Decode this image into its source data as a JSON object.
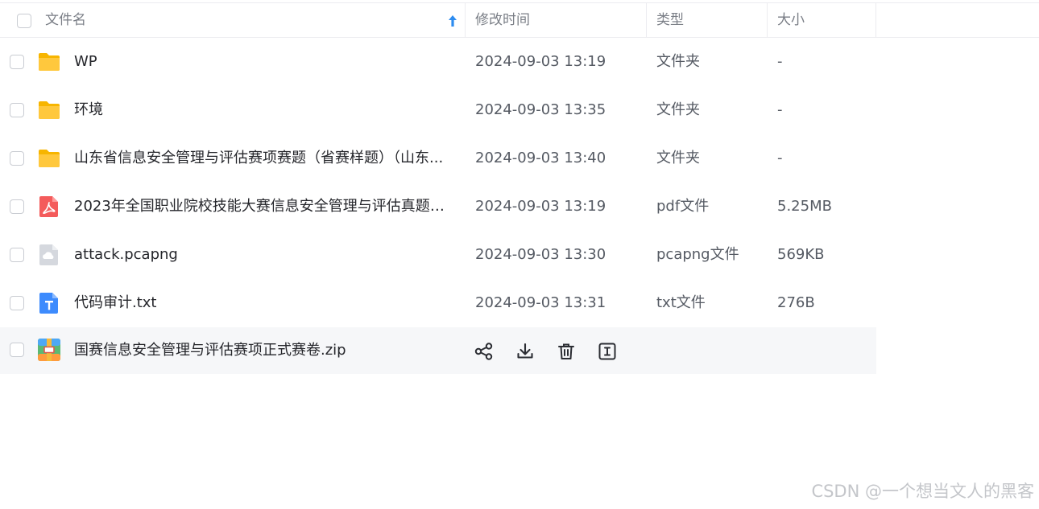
{
  "header": {
    "col_name": "文件名",
    "col_mtime": "修改时间",
    "col_type": "类型",
    "col_size": "大小"
  },
  "files": [
    {
      "name": "WP",
      "mtime": "2024-09-03 13:19",
      "type": "文件夹",
      "size": "-",
      "icon": "folder-icon"
    },
    {
      "name": "环境",
      "mtime": "2024-09-03 13:35",
      "type": "文件夹",
      "size": "-",
      "icon": "folder-icon"
    },
    {
      "name": "山东省信息安全管理与评估赛项赛题（省赛样题）（山东...",
      "mtime": "2024-09-03 13:40",
      "type": "文件夹",
      "size": "-",
      "icon": "folder-icon"
    },
    {
      "name": "2023年全国职业院校技能大赛信息安全管理与评估真题+...",
      "mtime": "2024-09-03 13:19",
      "type": "pdf文件",
      "size": "5.25MB",
      "icon": "pdf-icon"
    },
    {
      "name": "attack.pcapng",
      "mtime": "2024-09-03 13:30",
      "type": "pcapng文件",
      "size": "569KB",
      "icon": "generic-file-icon"
    },
    {
      "name": "代码审计.txt",
      "mtime": "2024-09-03 13:31",
      "type": "txt文件",
      "size": "276B",
      "icon": "txt-icon"
    },
    {
      "name": "国赛信息安全管理与评估赛项正式赛卷.zip",
      "mtime": "",
      "type": "",
      "size": "",
      "icon": "zip-icon"
    }
  ],
  "hover_actions": [
    "share-icon",
    "download-icon",
    "delete-icon",
    "rename-icon"
  ],
  "watermark": "CSDN @一个想当文人的黑客",
  "colors": {
    "folder": "#FFC42E",
    "pdf": "#F45B5B",
    "txt": "#3D8BFD",
    "sort_arrow": "#2D8CF0"
  }
}
